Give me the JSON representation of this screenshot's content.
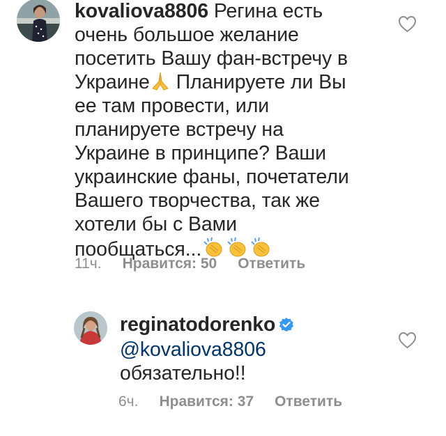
{
  "comments": [
    {
      "username": "kovaliova8806",
      "text_line1": " Регина есть",
      "text_line2": "очень большое желание",
      "text_line3": "посетить Вашу фан-встречу в",
      "text_line4a": "Украине",
      "text_line4b": " Планируете ли Вы",
      "text_line5": "ее там провести, или",
      "text_line6": "планируете встречу на",
      "text_line7": "Украине в принципе? Ваши",
      "text_line8": "украинские фаны, почетатели",
      "text_line9": "Вашего творчества, так же",
      "text_line10": "хотели бы с Вами",
      "text_line11": "пообщаться...",
      "time": "11ч.",
      "likes": "Нравится: 50",
      "reply": "Ответить",
      "icons": {
        "avatar": "avatar-photo",
        "pray": "folded-hands-emoji",
        "clap": "clapping-hands-emoji",
        "like": "heart-outline-icon"
      }
    },
    {
      "username": "reginatodorenko",
      "mention": "@kovaliova8806",
      "text": "обязательно!!",
      "time": "6ч.",
      "likes": "Нравится: 37",
      "reply": "Ответить",
      "icons": {
        "avatar": "avatar-photo",
        "verified": "verified-badge-icon",
        "like": "heart-outline-icon"
      }
    }
  ],
  "colors": {
    "text": "#262626",
    "meta": "#8e8e8e",
    "mention": "#003569",
    "verified": "#3897f0"
  }
}
